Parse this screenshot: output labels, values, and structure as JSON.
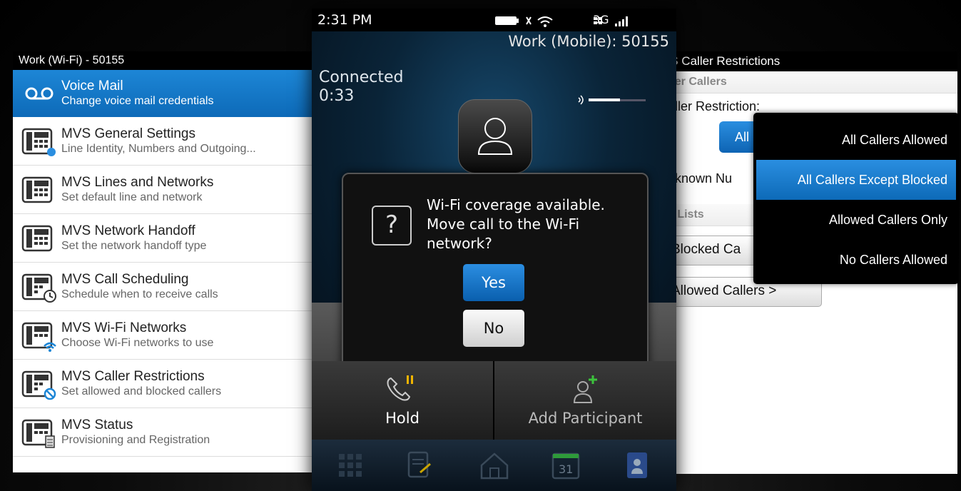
{
  "left_screen": {
    "title": "Work (Wi-Fi) - 50155",
    "items": [
      {
        "title": "Voice Mail",
        "subtitle": "Change voice mail credentials",
        "icon": "voicemail-icon",
        "selected": true
      },
      {
        "title": "MVS General Settings",
        "subtitle": "Line Identity, Numbers and Outgoing...",
        "icon": "phone-settings-icon"
      },
      {
        "title": "MVS Lines and Networks",
        "subtitle": "Set default line and network",
        "icon": "desk-phone-icon"
      },
      {
        "title": "MVS Network Handoff",
        "subtitle": "Set the network handoff type",
        "icon": "desk-phone-icon"
      },
      {
        "title": "MVS Call Scheduling",
        "subtitle": "Schedule when to receive calls",
        "icon": "phone-clock-icon"
      },
      {
        "title": "MVS Wi-Fi Networks",
        "subtitle": "Choose Wi-Fi networks to use",
        "icon": "phone-wifi-icon"
      },
      {
        "title": "MVS Caller Restrictions",
        "subtitle": "Set allowed and blocked callers",
        "icon": "phone-blocked-icon"
      },
      {
        "title": "MVS Status",
        "subtitle": "Provisioning and Registration",
        "icon": "phone-status-icon"
      }
    ]
  },
  "phone": {
    "status_bar": {
      "time": "2:31 PM",
      "network": "3G"
    },
    "account": "Work (Mobile): 50155",
    "call_state": "Connected",
    "call_duration": "0:33",
    "volume_level": 0.55,
    "dialog": {
      "message": "Wi-Fi coverage available. Move call to the Wi-Fi network?",
      "yes_label": "Yes",
      "no_label": "No"
    },
    "actions": {
      "hold_label": "Hold",
      "add_participant_label": "Add Participant"
    },
    "dock": {
      "calendar_day": "31"
    }
  },
  "right_screen": {
    "title": "'S Caller Restrictions",
    "section_filter": "lter Callers",
    "caller_restriction_label": "aller Restriction:",
    "restriction_button": "All",
    "unknown_label": "nknown Nu",
    "section_lists": "ll Lists",
    "blocked_button": "Blocked Ca",
    "allowed_button": "Allowed Callers >",
    "popup_options": [
      {
        "label": "All Callers Allowed",
        "selected": false
      },
      {
        "label": "All Callers Except Blocked",
        "selected": true
      },
      {
        "label": "Allowed Callers Only",
        "selected": false
      },
      {
        "label": "No Callers Allowed",
        "selected": false
      }
    ]
  },
  "colors": {
    "accent_blue": "#1d86d6",
    "background": "#000000"
  }
}
